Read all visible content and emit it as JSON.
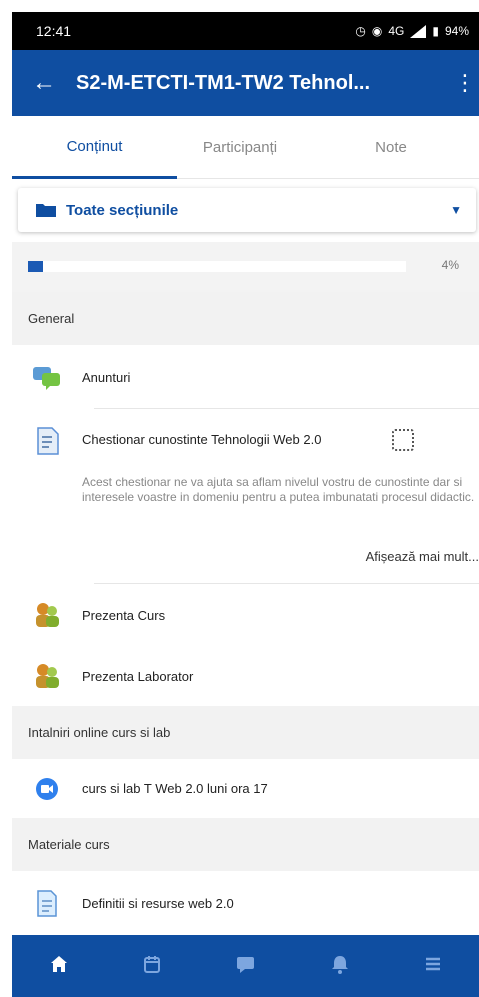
{
  "status": {
    "time": "12:41",
    "signal": "4G",
    "battery": "94%"
  },
  "header": {
    "title": "S2-M-ETCTI-TM1-TW2 Tehnol..."
  },
  "tabs": [
    {
      "label": "Conținut"
    },
    {
      "label": "Participanți"
    },
    {
      "label": "Note"
    }
  ],
  "section_select": {
    "label": "Toate secțiunile"
  },
  "progress": {
    "value_percent": 4,
    "label": "4%"
  },
  "sections": {
    "general": "General",
    "online": "Intalniri online curs si lab",
    "materials": "Materiale curs"
  },
  "items": {
    "announcements": "Anunturi",
    "questionnaire_title": "Chestionar cunostinte Tehnologii Web 2.0",
    "questionnaire_description": "Acest chestionar ne va ajuta sa aflam nivelul vostru de cunostinte dar si interesele voastre in domeniu pentru a putea imbunatati procesul didactic.",
    "show_more": "Afișează mai mult...",
    "attendance_course": "Prezenta Curs",
    "attendance_lab": "Prezenta Laborator",
    "meeting": "curs si lab T Web 2.0 luni ora 17",
    "web_resources": "Definitii si resurse web 2.0"
  },
  "colors": {
    "primary": "#0f4ea1",
    "progress": "#1b5ab4"
  },
  "icons": {
    "back": "arrow-left-icon",
    "menu": "kebab-menu-icon",
    "home": "home-icon",
    "calendar": "calendar-icon",
    "messages": "messages-icon",
    "notifications": "bell-icon",
    "more": "hamburger-icon"
  }
}
